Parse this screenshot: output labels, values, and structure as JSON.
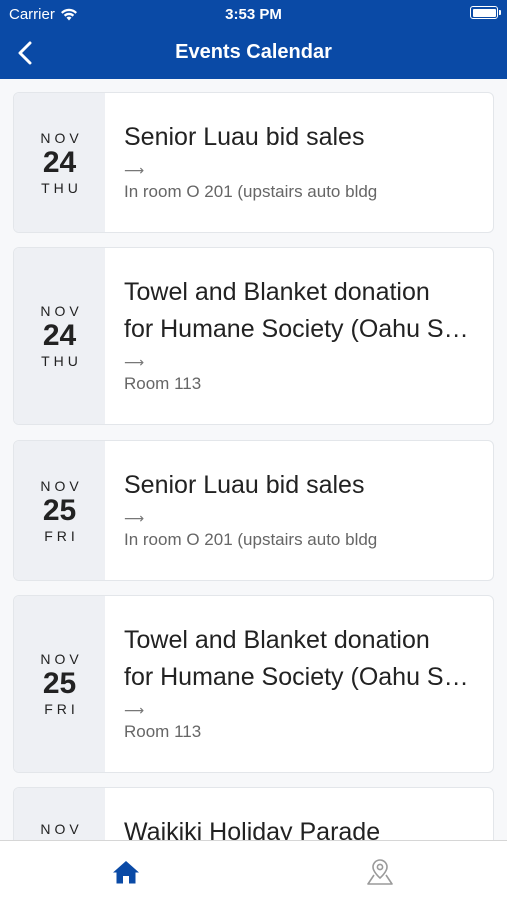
{
  "status_bar": {
    "carrier": "Carrier",
    "time": "3:53 PM"
  },
  "header": {
    "title": "Events Calendar"
  },
  "events": [
    {
      "month": "NOV",
      "day": "24",
      "weekday": "THU",
      "title_line1": "Senior Luau bid sales",
      "title_line2": "",
      "arrow": "⟶",
      "location": "In room O 201 (upstairs auto bldg"
    },
    {
      "month": "NOV",
      "day": "24",
      "weekday": "THU",
      "title_line1": "Towel and Blanket donation",
      "title_line2": "for Humane Society (Oahu S…",
      "arrow": "⟶",
      "location": "Room 113"
    },
    {
      "month": "NOV",
      "day": "25",
      "weekday": "FRI",
      "title_line1": "Senior Luau bid sales",
      "title_line2": "",
      "arrow": "⟶",
      "location": "In room O 201 (upstairs auto bldg"
    },
    {
      "month": "NOV",
      "day": "25",
      "weekday": "FRI",
      "title_line1": "Towel and Blanket donation",
      "title_line2": "for Humane Society (Oahu S…",
      "arrow": "⟶",
      "location": "Room 113"
    },
    {
      "month": "NOV",
      "day": "",
      "weekday": "",
      "title_line1": "Waikiki Holiday Parade",
      "title_line2": "",
      "arrow": "",
      "location": ""
    }
  ],
  "tabs": [
    {
      "icon": "home-icon",
      "active": true
    },
    {
      "icon": "map-pin-icon",
      "active": false
    }
  ],
  "colors": {
    "brand": "#0a4aa6",
    "date_bg": "#eef0f4",
    "tab_active": "#0a4aa6",
    "tab_inactive": "#9a9a9a"
  }
}
